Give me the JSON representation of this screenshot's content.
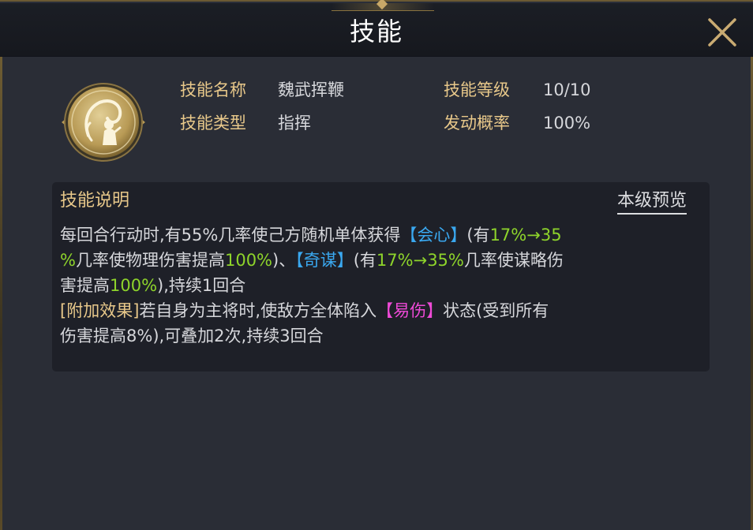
{
  "window": {
    "title": "技能",
    "close_icon": "close-icon"
  },
  "skill": {
    "icon": "whip-warrior-icon",
    "name_label": "技能名称",
    "name_value": "魏武挥鞭",
    "type_label": "技能类型",
    "type_value": "指挥",
    "level_label": "技能等级",
    "level_value": "10/10",
    "chance_label": "发动概率",
    "chance_value": "100%"
  },
  "description": {
    "title": "技能说明",
    "preview_link": "本级预览",
    "line1_a": "每回合行动时,有55%几率使己方随机单体获得",
    "line1_kw1": "【会心】",
    "line1_b": "(有",
    "line1_num1": "17%→35",
    "line2_num1": "%",
    "line2_a": "几率使物理伤害提高",
    "line2_num2": "100%",
    "line2_b": ")、",
    "line2_kw2": "【奇谋】",
    "line2_c": "(有",
    "line2_num3": "17%→35%",
    "line2_d": "几率使谋略伤",
    "line3_a": "害提高",
    "line3_num": "100%",
    "line3_b": "),持续1回合",
    "line4_tag": "[附加效果]",
    "line4_a": "若自身为主将时,使敌方全体陷入",
    "line4_kw": "【易伤】",
    "line4_b": "状态(受到所有",
    "line5": "伤害提高8%),可叠加2次,持续3回合"
  },
  "colors": {
    "keyword_blue": "#3aa8f0",
    "number_green": "#8ed42b",
    "label_gold": "#e8c88a",
    "debuff_pink": "#f04ad8"
  }
}
